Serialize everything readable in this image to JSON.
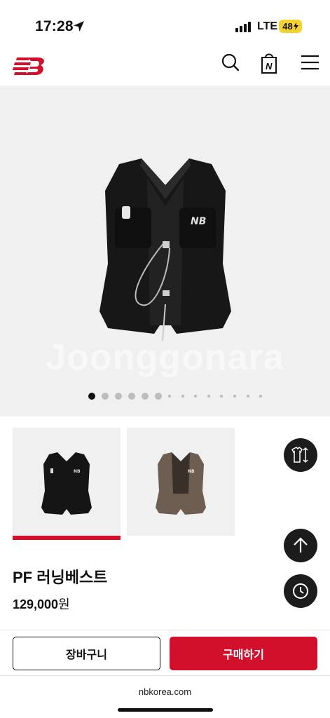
{
  "status_bar": {
    "time": "17:28",
    "network": "LTE",
    "battery": "48"
  },
  "header": {
    "logo_icon": "new-balance-logo",
    "search_icon": "search-icon",
    "bag_icon": "shopping-bag-icon",
    "bag_letter": "N",
    "menu_icon": "hamburger-menu-icon"
  },
  "gallery": {
    "watermark": "Joonggonara",
    "total_images": 14,
    "active_index": 0
  },
  "thumbnails": [
    {
      "label": "black",
      "color": "#1a1a1a"
    },
    {
      "label": "brown",
      "color": "#6e5e52"
    }
  ],
  "fabs": {
    "size_guide_icon": "shirt-size-icon",
    "scroll_top_icon": "arrow-up-icon",
    "recent_icon": "clock-icon"
  },
  "product": {
    "name": "PF 러닝베스트",
    "price": "129,000",
    "currency": "원"
  },
  "actions": {
    "cart_label": "장바구니",
    "buy_label": "구매하기"
  },
  "browser": {
    "url": "nbkorea.com"
  },
  "colors": {
    "brand_red": "#d2102c",
    "fab_bg": "#1c1c1c"
  }
}
